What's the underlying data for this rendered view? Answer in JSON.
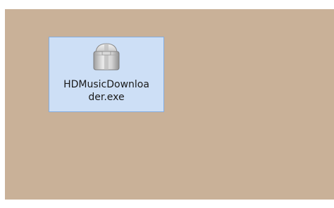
{
  "desktop": {
    "background": "#c9b198",
    "items": [
      {
        "icon": "installer-package-icon",
        "label_line1": "HDMusicDownloa",
        "label_line2": "der.exe",
        "selected": true,
        "selection_color": "#cddff6",
        "selection_border": "#84acdd"
      }
    ]
  }
}
